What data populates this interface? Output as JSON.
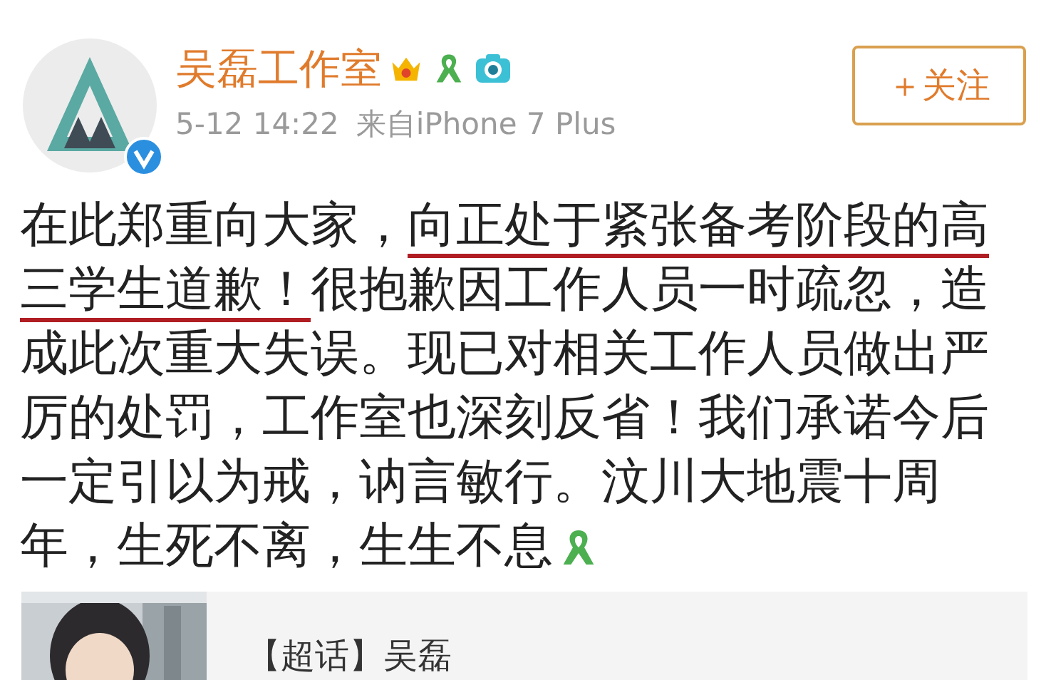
{
  "author": {
    "name": "吴磊工作室",
    "verified": true
  },
  "meta": {
    "time": "5-12 14:22",
    "source": "来自iPhone 7 Plus"
  },
  "follow_button": {
    "label": "＋关注"
  },
  "body": [
    {
      "text": "在此郑重向大家，",
      "underlined": false
    },
    {
      "text": "向正处于紧张备考阶段的高三学生道歉！",
      "underlined": true
    },
    {
      "text": "很抱歉因工作人员一时疏忽，造成此次重大失误。现已对相关工作人员做出严厉的处罚，工作室也深刻反省！我们承诺今后一定引以为戒，讷言敏行。汶川大地震十周",
      "underlined": false
    }
  ],
  "body_last_line": "年，生死不离，生生不息",
  "topic_card": {
    "title": "【超话】吴磊"
  }
}
